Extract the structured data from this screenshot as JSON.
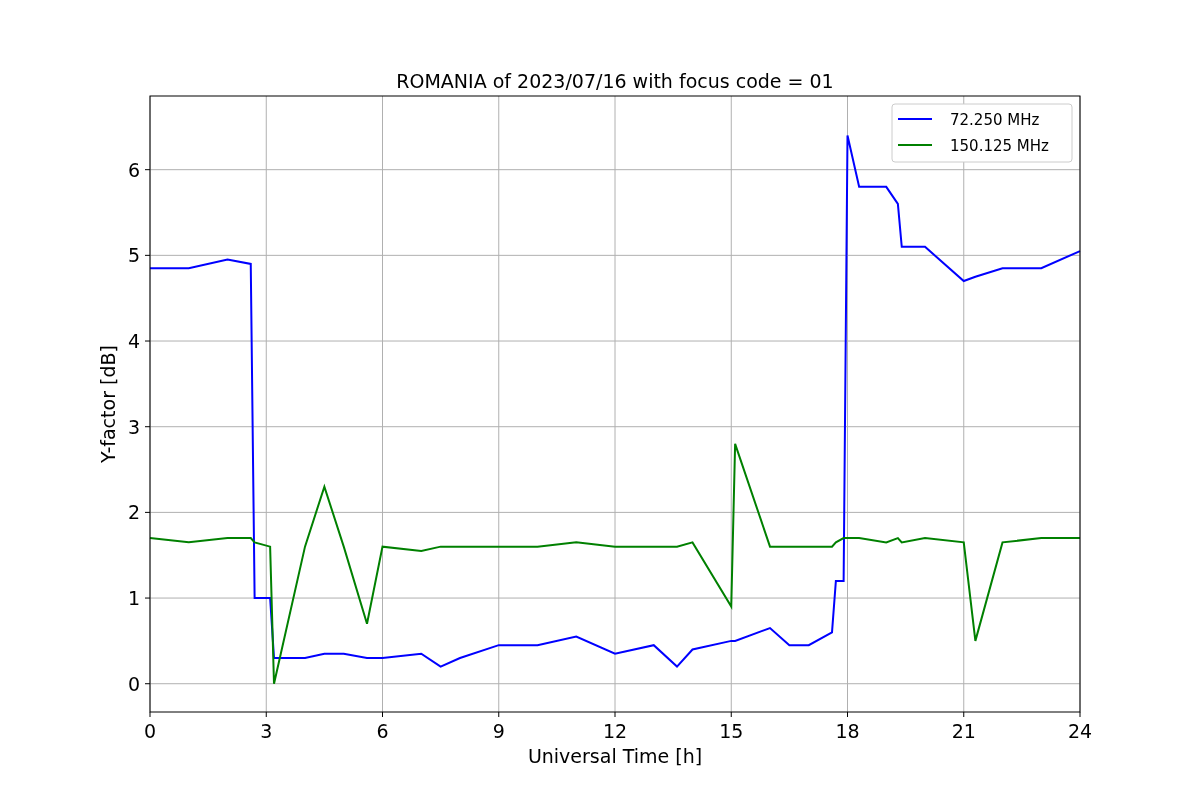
{
  "chart_data": {
    "type": "line",
    "title": "ROMANIA of 2023/07/16 with focus code = 01",
    "xlabel": "Universal Time [h]",
    "ylabel": "Y-factor [dB]",
    "x": [
      0,
      1,
      2,
      2.6,
      2.7,
      3.1,
      3.2,
      4,
      4.5,
      5,
      5.6,
      6,
      7,
      7.5,
      8,
      9,
      10,
      11,
      12,
      13,
      13.6,
      14,
      15,
      15.1,
      16,
      16.5,
      17,
      17.6,
      17.7,
      17.9,
      18,
      18.3,
      19,
      19.3,
      19.4,
      20,
      21,
      21.3,
      22,
      23,
      24
    ],
    "series": [
      {
        "name": "72.250 MHz",
        "color": "#0000ff",
        "values": [
          4.85,
          4.85,
          4.95,
          4.9,
          1.0,
          1.0,
          0.3,
          0.3,
          0.35,
          0.35,
          0.3,
          0.3,
          0.35,
          0.2,
          0.3,
          0.45,
          0.45,
          0.55,
          0.35,
          0.45,
          0.2,
          0.4,
          0.5,
          0.5,
          0.65,
          0.45,
          0.45,
          0.6,
          1.2,
          1.2,
          6.4,
          5.8,
          5.8,
          5.6,
          5.1,
          5.1,
          4.7,
          4.75,
          4.85,
          4.85,
          5.05
        ]
      },
      {
        "name": "150.125 MHz",
        "color": "#008000",
        "values": [
          1.7,
          1.65,
          1.7,
          1.7,
          1.65,
          1.6,
          0.0,
          1.6,
          2.3,
          1.6,
          0.7,
          1.6,
          1.55,
          1.6,
          1.6,
          1.6,
          1.6,
          1.65,
          1.6,
          1.6,
          1.6,
          1.65,
          0.9,
          2.8,
          1.6,
          1.6,
          1.6,
          1.6,
          1.65,
          1.7,
          1.7,
          1.7,
          1.65,
          1.7,
          1.65,
          1.7,
          1.65,
          0.5,
          1.65,
          1.7,
          1.7
        ]
      }
    ],
    "xlim": [
      0,
      24
    ],
    "ylim": [
      -0.33,
      6.86
    ],
    "xticks": [
      0,
      3,
      6,
      9,
      12,
      15,
      18,
      21,
      24
    ],
    "yticks": [
      0,
      1,
      2,
      3,
      4,
      5,
      6
    ],
    "grid": true,
    "legend": true
  }
}
